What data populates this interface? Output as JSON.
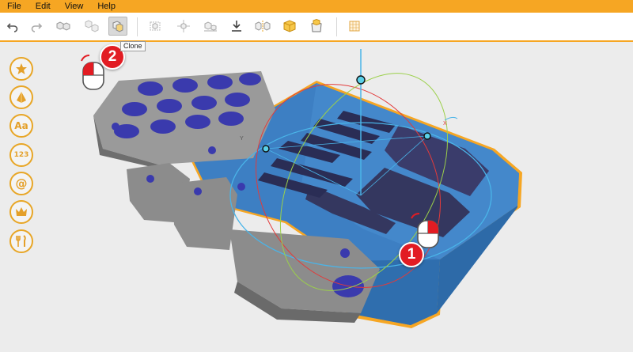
{
  "menu": {
    "items": [
      {
        "label": "File"
      },
      {
        "label": "Edit"
      },
      {
        "label": "View"
      },
      {
        "label": "Help"
      }
    ]
  },
  "toolbar": {
    "buttons": [
      {
        "icon": "undo-icon"
      },
      {
        "icon": "redo-icon"
      },
      {
        "icon": "group-icon"
      },
      {
        "icon": "ungroup-icon"
      },
      {
        "icon": "clone-icon"
      },
      {
        "icon": "align-icon"
      },
      {
        "icon": "distribute-icon"
      },
      {
        "icon": "arrange-icon"
      },
      {
        "icon": "drop-to-floor-icon"
      },
      {
        "icon": "mirror-icon"
      },
      {
        "icon": "hollow-cube-icon"
      },
      {
        "icon": "delete-cube-icon"
      },
      {
        "icon": "grid-icon"
      }
    ],
    "clone_tooltip": "Clone"
  },
  "sidebar": {
    "items": [
      {
        "icon": "star-icon"
      },
      {
        "icon": "shapes-icon"
      },
      {
        "icon": "text-icon",
        "label": "Aa"
      },
      {
        "icon": "number-icon",
        "label": "123"
      },
      {
        "icon": "at-icon",
        "label": "@"
      },
      {
        "icon": "crown-icon"
      },
      {
        "icon": "tools-icon"
      }
    ]
  },
  "viewport": {
    "axis_labels": {
      "y": "Y",
      "x": "X"
    },
    "callouts": [
      "1",
      "2"
    ]
  },
  "colors": {
    "accent": "#f6a623",
    "selected_part": "#3d7fc3",
    "model_gray": "#8a8a8a",
    "model_blue": "#3a3aad",
    "callout_red": "#e21c23"
  }
}
